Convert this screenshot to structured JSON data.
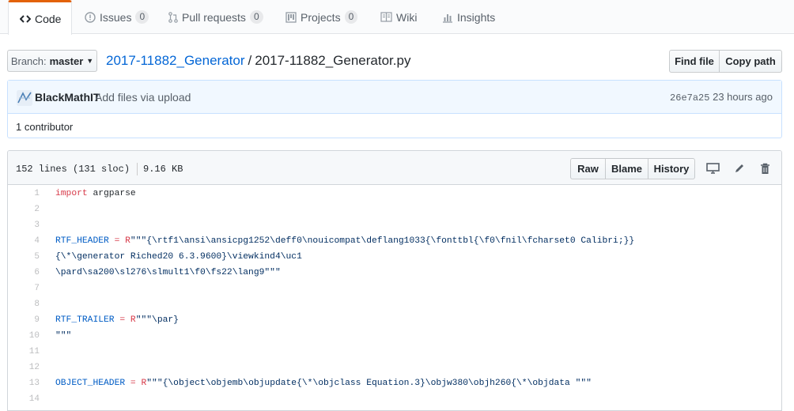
{
  "tabs": [
    {
      "label": "Code",
      "count": null,
      "icon": "code-icon"
    },
    {
      "label": "Issues",
      "count": "0",
      "icon": "issue-icon"
    },
    {
      "label": "Pull requests",
      "count": "0",
      "icon": "pull-request-icon"
    },
    {
      "label": "Projects",
      "count": "0",
      "icon": "project-icon"
    },
    {
      "label": "Wiki",
      "count": null,
      "icon": "book-icon"
    },
    {
      "label": "Insights",
      "count": null,
      "icon": "graph-icon"
    }
  ],
  "branch": {
    "label": "Branch:",
    "value": "master"
  },
  "breadcrumb": {
    "repo": "2017-11882_Generator",
    "separator": "/",
    "file": "2017-11882_Generator.py"
  },
  "actions": {
    "find_file": "Find file",
    "copy_path": "Copy path"
  },
  "commit": {
    "author": "BlackMathIT",
    "message": "Add files via upload",
    "sha": "26e7a25",
    "time": "23 hours ago"
  },
  "contributors": "1 contributor",
  "file": {
    "lines_info": "152 lines (131 sloc)",
    "size": "9.16 KB",
    "buttons": {
      "raw": "Raw",
      "blame": "Blame",
      "history": "History"
    }
  },
  "code_lines": [
    {
      "n": "1",
      "tokens": [
        {
          "t": "import",
          "c": "kw"
        },
        {
          "t": " argparse",
          "c": ""
        }
      ]
    },
    {
      "n": "2",
      "tokens": []
    },
    {
      "n": "3",
      "tokens": []
    },
    {
      "n": "4",
      "tokens": [
        {
          "t": "RTF_HEADER",
          "c": "cn"
        },
        {
          "t": " ",
          "c": ""
        },
        {
          "t": "=",
          "c": "kw"
        },
        {
          "t": " ",
          "c": ""
        },
        {
          "t": "R",
          "c": "kw"
        },
        {
          "t": "\"\"\"{\\rtf1\\ansi\\ansicpg1252\\deff0\\nouicompat\\deflang1033{\\fonttbl{\\f0\\fnil\\fcharset0 Calibri;}}",
          "c": "st"
        }
      ]
    },
    {
      "n": "5",
      "tokens": [
        {
          "t": "{\\*\\generator Riched20 6.3.9600}\\viewkind4\\uc1",
          "c": "st"
        }
      ]
    },
    {
      "n": "6",
      "tokens": [
        {
          "t": "\\pard\\sa200\\sl276\\slmult1\\f0\\fs22\\lang9\"\"\"",
          "c": "st"
        }
      ]
    },
    {
      "n": "7",
      "tokens": []
    },
    {
      "n": "8",
      "tokens": []
    },
    {
      "n": "9",
      "tokens": [
        {
          "t": "RTF_TRAILER",
          "c": "cn"
        },
        {
          "t": " ",
          "c": ""
        },
        {
          "t": "=",
          "c": "kw"
        },
        {
          "t": " ",
          "c": ""
        },
        {
          "t": "R",
          "c": "kw"
        },
        {
          "t": "\"\"\"\\par}",
          "c": "st"
        }
      ]
    },
    {
      "n": "10",
      "tokens": [
        {
          "t": "\"\"\"",
          "c": "st"
        }
      ]
    },
    {
      "n": "11",
      "tokens": []
    },
    {
      "n": "12",
      "tokens": []
    },
    {
      "n": "13",
      "tokens": [
        {
          "t": "OBJECT_HEADER",
          "c": "cn"
        },
        {
          "t": " ",
          "c": ""
        },
        {
          "t": "=",
          "c": "kw"
        },
        {
          "t": " ",
          "c": ""
        },
        {
          "t": "R",
          "c": "kw"
        },
        {
          "t": "\"\"\"{\\object\\objemb\\objupdate{\\*\\objclass Equation.3}\\objw380\\objh260{\\*\\objdata \"\"\"",
          "c": "st"
        }
      ]
    },
    {
      "n": "14",
      "tokens": []
    }
  ]
}
